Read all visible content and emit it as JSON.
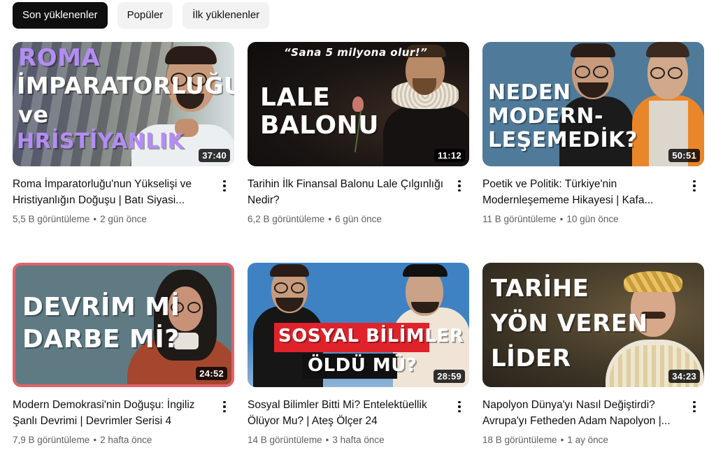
{
  "chips": [
    {
      "label": "Son yüklenenler",
      "active": true
    },
    {
      "label": "Popüler",
      "active": false
    },
    {
      "label": "İlk yüklenenler",
      "active": false
    }
  ],
  "videos": [
    {
      "title": "Roma İmparatorluğu'nun Yükselişi ve Hristiyanlığın Doğuşu | Batı Siyasi...",
      "views": "5,5 B görüntüleme",
      "age": "2 gün önce",
      "duration": "37:40",
      "thumb_lines": [
        "ROMA",
        "İMPARATORLUĞU",
        "ve",
        "HRİSTİYANLIK"
      ]
    },
    {
      "title": "Tarihin İlk Finansal Balonu Lale Çılgınlığı Nedir?",
      "views": "6,2 B görüntüleme",
      "age": "6 gün önce",
      "duration": "11:12",
      "thumb_quote": "“Sana 5  milyona olur!”",
      "thumb_lines": [
        "LALE",
        "BALONU"
      ]
    },
    {
      "title": "Poetik ve Politik: Türkiye'nin Modernleşememe Hikayesi | Kafa...",
      "views": "11 B görüntüleme",
      "age": "10 gün önce",
      "duration": "50:51",
      "thumb_lines": [
        "NEDEN",
        "MODERN-",
        "LEŞEMEDİK?"
      ]
    },
    {
      "title": "Modern Demokrasi'nin Doğuşu: İngiliz Şanlı Devrimi | Devrimler Serisi 4",
      "views": "7,9 B görüntüleme",
      "age": "2 hafta önce",
      "duration": "24:52",
      "thumb_lines": [
        "DEVRİM Mİ",
        "DARBE Mİ?"
      ]
    },
    {
      "title": "Sosyal Bilimler Bitti Mi? Entelektüellik Ölüyor Mu? | Ateş Ölçer 24",
      "views": "14 B görüntüleme",
      "age": "3 hafta önce",
      "duration": "28:59",
      "thumb_lines": [
        "SOSYAL BİLİMLER",
        "ÖLDÜ MÜ?"
      ]
    },
    {
      "title": "Napolyon Dünya'yı Nasıl Değiştirdi? Avrupa'yı Fetheden Adam Napolyon |...",
      "views": "18 B görüntüleme",
      "age": "1 ay önce",
      "duration": "34:23",
      "thumb_lines": [
        "TARİHE",
        "YÖN VEREN",
        "LİDER"
      ]
    }
  ],
  "icons": {
    "menu": "more-vert-icon"
  },
  "colors": {
    "chip_active_bg": "#0f0f0f",
    "chip_bg": "#f2f2f2",
    "meta_text": "#606060"
  }
}
